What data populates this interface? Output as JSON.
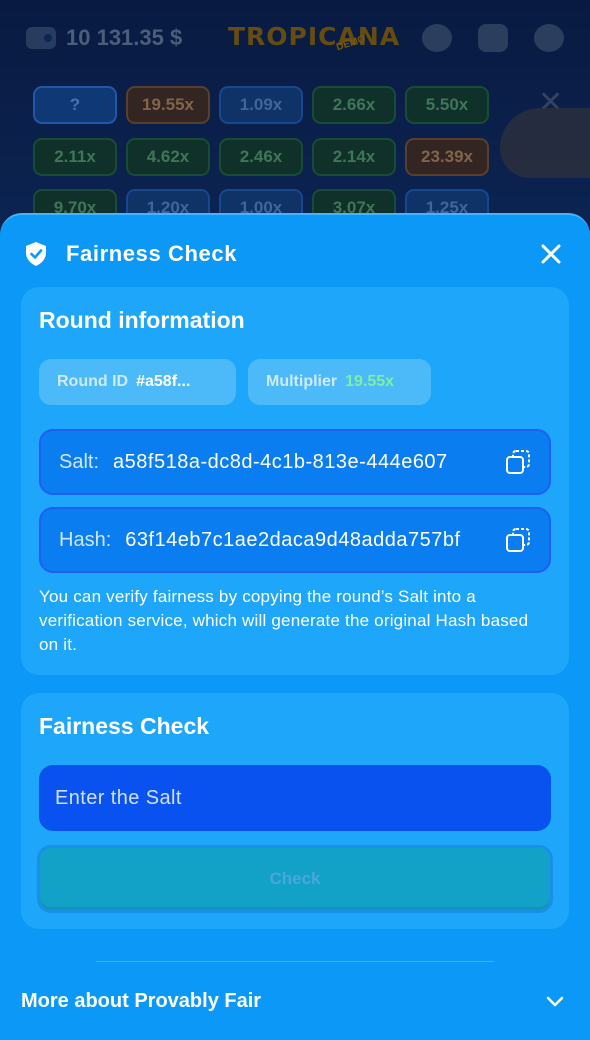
{
  "topbar": {
    "balance": "10 131.35 $",
    "logo": "TROPICANA",
    "logo_badge": "DEMO",
    "icons": [
      "wallet-icon",
      "users-icon",
      "chat-icon",
      "settings-icon"
    ]
  },
  "history": [
    {
      "label": "?",
      "color": "selected"
    },
    {
      "label": "19.55x",
      "color": "orange"
    },
    {
      "label": "1.09x",
      "color": "blue"
    },
    {
      "label": "2.66x",
      "color": "green"
    },
    {
      "label": "5.50x",
      "color": "green"
    },
    {
      "label": "2.11x",
      "color": "green"
    },
    {
      "label": "4.62x",
      "color": "green"
    },
    {
      "label": "2.46x",
      "color": "green"
    },
    {
      "label": "2.14x",
      "color": "green"
    },
    {
      "label": "23.39x",
      "color": "orange"
    },
    {
      "label": "9.70x",
      "color": "green"
    },
    {
      "label": "1.20x",
      "color": "blue"
    },
    {
      "label": "1.00x",
      "color": "blue"
    },
    {
      "label": "3.07x",
      "color": "green"
    },
    {
      "label": "1.25x",
      "color": "blue"
    }
  ],
  "modal": {
    "title": "Fairness Check",
    "round_info": {
      "title": "Round information",
      "round_id_label": "Round ID",
      "round_id_value": "#a58f...",
      "multiplier_label": "Multiplier",
      "multiplier_value": "19.55x",
      "salt_label": "Salt:",
      "salt_value": "a58f518a-dc8d-4c1b-813e-444e607",
      "hash_label": "Hash:",
      "hash_value": "63f14eb7c1ae2daca9d48adda757bf",
      "note": "You can verify fairness by copying the round’s Salt into a verification service, which will generate the original Hash based on it."
    },
    "check": {
      "title": "Fairness Check",
      "input_placeholder": "Enter the Salt",
      "input_value": "",
      "button_label": "Check"
    },
    "more_label": "More about Provably Fair"
  },
  "colors": {
    "modal_bg": "#0c98f6",
    "card_bg": "#1ea6fa",
    "field_bg": "#0a7ef0",
    "input_bg": "#0a52f0",
    "button_bg": "#12a2c8",
    "multiplier_green": "#7ef0a0"
  }
}
